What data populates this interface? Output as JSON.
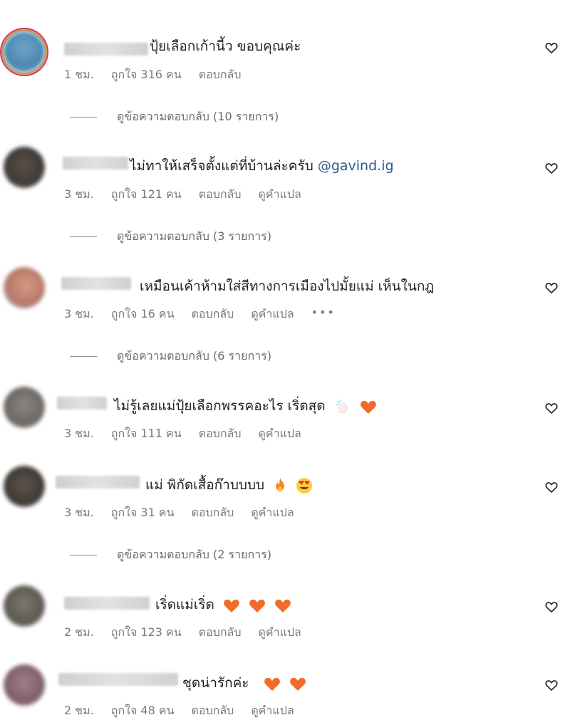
{
  "comments": [
    {
      "text": "ปุ้ยเลือกเก้านี้ว ขอบคุณค่ะ",
      "likes": "316",
      "time": "1 ชม.",
      "likes_label": "ถูกใจ 316 คน",
      "reply_label": "ตอบกลับ",
      "replies_label": "ดูข้อความตอบกลับ (10 รายการ)"
    },
    {
      "text": "ไม่ทาให้เสร็จตั้งแต่ที่บ้านล่ะครับ",
      "mention": "@gavind.ig",
      "time": "3 ชม.",
      "likes_label": "ถูกใจ 121 คน",
      "reply_label": "ตอบกลับ",
      "translate_label": "ดูคำแปล",
      "replies_label": "ดูข้อความตอบกลับ (3 รายการ)"
    },
    {
      "text": "เหมือนเค้าห้ามใส่สีทางการเมืองไปมั้ยแม่ เห็นในกฎ",
      "time": "3 ชม.",
      "likes_label": "ถูกใจ 16 คน",
      "reply_label": "ตอบกลับ",
      "translate_label": "ดูคำแปล",
      "more_label": "•••",
      "replies_label": "ดูข้อความตอบกลับ (6 รายการ)"
    },
    {
      "text": "ไม่รู้เลยแม่ปุ้ยเลือกพรรคอะไร เริ่ดสุด",
      "time": "3 ชม.",
      "likes_label": "ถูกใจ 111 คน",
      "reply_label": "ตอบกลับ",
      "translate_label": "ดูคำแปล"
    },
    {
      "text": "แม่ พิกัดเสื้อก๊าบบบบ",
      "time": "3 ชม.",
      "likes_label": "ถูกใจ 31 คน",
      "reply_label": "ตอบกลับ",
      "translate_label": "ดูคำแปล",
      "replies_label": "ดูข้อความตอบกลับ (2 รายการ)"
    },
    {
      "text": "เริ่ดแม่เริ่ด",
      "time": "2 ชม.",
      "likes_label": "ถูกใจ 123 คน",
      "reply_label": "ตอบกลับ",
      "translate_label": "ดูคำแปล"
    },
    {
      "text": "ชุดน่ารักค่ะ",
      "time": "2 ชม.",
      "likes_label": "ถูกใจ 48 คน",
      "reply_label": "ตอบกลับ",
      "translate_label": "ดูคำแปล"
    }
  ],
  "icons": {
    "like": "heart-outline-icon",
    "orange_heart": "orange-heart-emoji",
    "fire": "fire-emoji",
    "heart_eyes": "heart-eyes-emoji",
    "clap": "clapping-hands-emoji"
  },
  "colors": {
    "text": "#262626",
    "meta": "#7a7a7a",
    "mention": "#2b5a8c",
    "orange_heart": "#f26b2a"
  }
}
